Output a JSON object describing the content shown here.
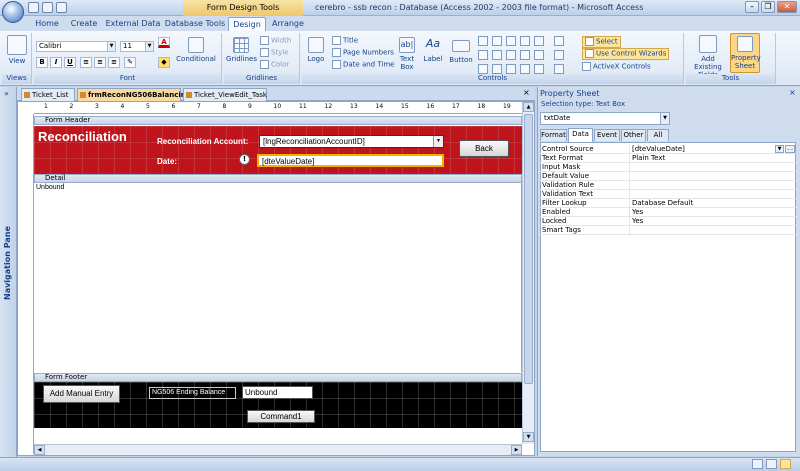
{
  "window": {
    "title": "cerebro - ssb recon : Database (Access 2002 - 2003 file format) - Microsoft Access",
    "contextual_tab_group": "Form Design Tools",
    "controls": [
      "–",
      "❐",
      "✕"
    ]
  },
  "ribbon_tabs": [
    {
      "label": "Home"
    },
    {
      "label": "Create"
    },
    {
      "label": "External Data"
    },
    {
      "label": "Database Tools"
    },
    {
      "label": "Design"
    },
    {
      "label": "Arrange"
    }
  ],
  "ribbon": {
    "views": {
      "view_label": "View",
      "group_label": "Views"
    },
    "font": {
      "font_name": "Calibri",
      "font_size": "11",
      "bold": "B",
      "italic": "I",
      "underline": "U",
      "conditional_label": "Conditional",
      "group_label": "Font"
    },
    "gridlines": {
      "gridlines_label": "Gridlines",
      "width_label": "Width",
      "style_label": "Style",
      "color_label": "Color",
      "group_label": "Gridlines"
    },
    "controls": {
      "logo_label": "Logo",
      "title_label": "Title",
      "page_numbers_label": "Page Numbers",
      "date_time_label": "Date and Time",
      "textbox_label": "Text Box",
      "label_label": "Label",
      "button_label": "Button",
      "select_label": "Select",
      "wizards_label": "Use Control Wizards",
      "activex_label": "ActiveX Controls",
      "group_label": "Controls"
    },
    "tools": {
      "add_fields_label": "Add Existing Fields",
      "property_sheet_label": "Property Sheet",
      "group_label": "Tools"
    }
  },
  "doc_tabs": [
    {
      "label": "Ticket_List"
    },
    {
      "label": "frmReconNG506Balancing"
    },
    {
      "label": "Ticket_ViewEdit_Task"
    }
  ],
  "form": {
    "header_section": "Form Header",
    "title": "Reconciliation",
    "account_label": "Reconciliation Account:",
    "account_value": "[lngReconciliationAccountID]",
    "date_label": "Date:",
    "date_value": "[dteValueDate]",
    "back_button": "Back",
    "detail_section": "Detail",
    "detail_unbound": "Unbound",
    "footer_section": "Form Footer",
    "manual_entry_button": "Add Manual Entry",
    "ending_balance_label": "NG506 Ending Balance",
    "ending_balance_value": "Unbound",
    "command_button": "Command1"
  },
  "nav_pane": {
    "label": "Navigation Pane"
  },
  "property_sheet": {
    "title": "Property Sheet",
    "selection_type": "Selection type:  Text Box",
    "selected": "txtDate",
    "tabs": [
      "Format",
      "Data",
      "Event",
      "Other",
      "All"
    ],
    "active_tab": "Data",
    "rows": [
      {
        "name": "Control Source",
        "value": "[dteValueDate]"
      },
      {
        "name": "Text Format",
        "value": "Plain Text"
      },
      {
        "name": "Input Mask",
        "value": ""
      },
      {
        "name": "Default Value",
        "value": ""
      },
      {
        "name": "Validation Rule",
        "value": ""
      },
      {
        "name": "Validation Text",
        "value": ""
      },
      {
        "name": "Filter Lookup",
        "value": "Database Default"
      },
      {
        "name": "Enabled",
        "value": "Yes"
      },
      {
        "name": "Locked",
        "value": "Yes"
      },
      {
        "name": "Smart Tags",
        "value": ""
      }
    ]
  },
  "ruler_numbers": [
    "1",
    "2",
    "3",
    "4",
    "5",
    "6",
    "7",
    "8",
    "9",
    "10",
    "11",
    "12",
    "13",
    "14",
    "15",
    "16",
    "17",
    "18",
    "19"
  ],
  "colors": {
    "header_bg": "#c0141c",
    "footer_bg": "#000000",
    "accent": "#15428b"
  }
}
